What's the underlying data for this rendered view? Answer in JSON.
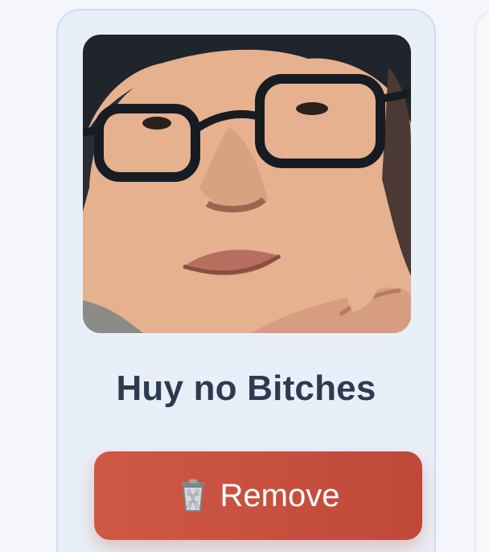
{
  "card": {
    "name": "Huy no Bitches",
    "remove_label": "Remove",
    "remove_icon": "trash-icon"
  },
  "colors": {
    "card_bg": "#e9eff8",
    "card_border": "#cfdcf0",
    "name_text": "#2d3a50",
    "remove_button": "#c9503f"
  }
}
